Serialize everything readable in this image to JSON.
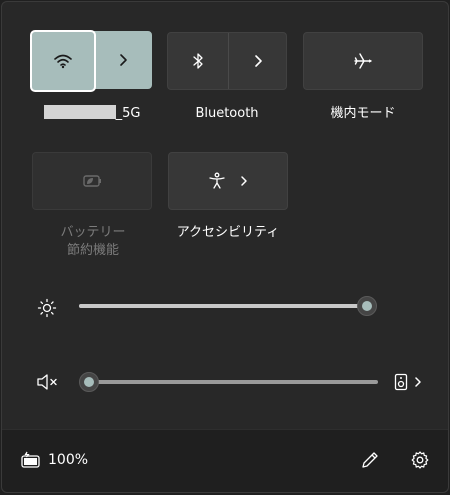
{
  "tiles": {
    "wifi": {
      "label_suffix": "5G",
      "icon": "wifi-icon",
      "state": "on"
    },
    "bluetooth": {
      "label": "Bluetooth",
      "icon": "bluetooth-icon",
      "state": "off"
    },
    "airplane": {
      "label": "機内モード",
      "icon": "airplane-icon",
      "state": "off"
    },
    "battery_saver": {
      "label_line1": "バッテリー",
      "label_line2": "節約機能",
      "icon": "battery-saver-icon",
      "state": "disabled"
    },
    "accessibility": {
      "label": "アクセシビリティ",
      "icon": "accessibility-icon"
    }
  },
  "brightness": {
    "icon": "brightness-icon",
    "level": 1.0
  },
  "volume": {
    "icon": "speaker-muted-icon",
    "level": 0.0,
    "output_icon": "speaker-device-icon"
  },
  "footer": {
    "battery_text": "100%",
    "battery_icon": "battery-icon",
    "edit_icon": "pencil-icon",
    "settings_icon": "gear-icon"
  },
  "colors": {
    "accent": "#a7bdbb",
    "background": "#282828",
    "tile_off": "#373737"
  }
}
